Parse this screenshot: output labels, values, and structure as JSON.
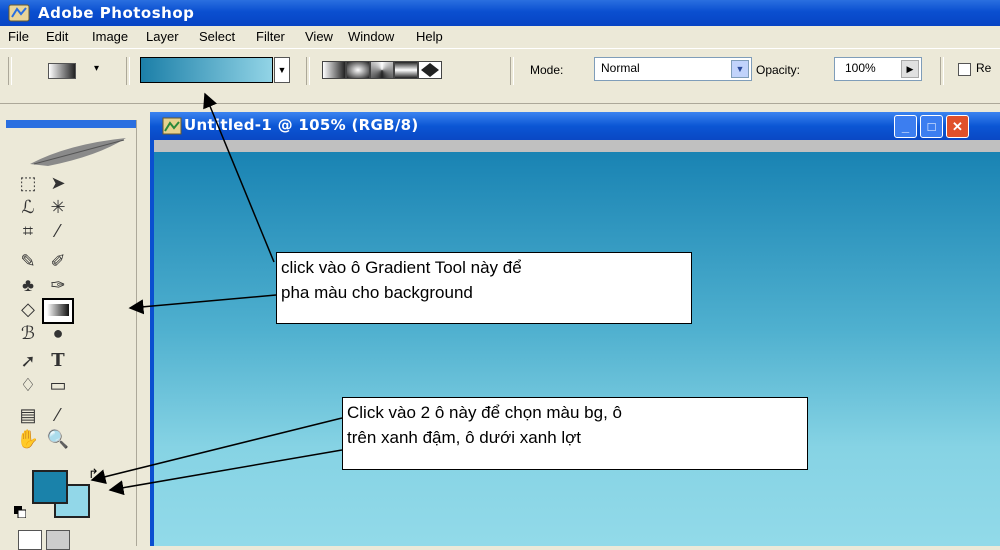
{
  "app": {
    "title": "Adobe Photoshop",
    "menu": [
      "File",
      "Edit",
      "Image",
      "Layer",
      "Select",
      "Filter",
      "View",
      "Window",
      "Help"
    ]
  },
  "options_bar": {
    "mode_label": "Mode:",
    "mode_value": "Normal",
    "opacity_label": "Opacity:",
    "opacity_value": "100%",
    "reverse_label": "Re",
    "gradient_colors": [
      "#1c7fa8",
      "#92d4e6"
    ]
  },
  "document": {
    "title": "Untitled-1 @ 105% (RGB/8)",
    "canvas_colors": [
      "#1983b3",
      "#92dae9"
    ]
  },
  "toolbox": {
    "foreground_color": "#1a82aa",
    "background_color": "#92d7e8",
    "tools": [
      "marquee-icon",
      "move-icon",
      "lasso-icon",
      "magic-wand-icon",
      "crop-icon",
      "slice-icon",
      "healing-icon",
      "brush-icon",
      "clone-stamp-icon",
      "history-brush-icon",
      "eraser-icon",
      "gradient-tool-icon",
      "blur-icon",
      "dodge-icon",
      "path-select-icon",
      "type-icon",
      "pen-icon",
      "shape-icon",
      "notes-icon",
      "eyedropper-icon",
      "hand-icon",
      "zoom-icon"
    ]
  },
  "callouts": {
    "gradient": {
      "line1": "click vào ô Gradient Tool này để",
      "line2": "pha màu cho background"
    },
    "colors": {
      "line1": "Click vào 2 ô này để chọn màu bg, ô",
      "line2": "trên xanh đậm, ô dưới xanh lợt"
    }
  }
}
